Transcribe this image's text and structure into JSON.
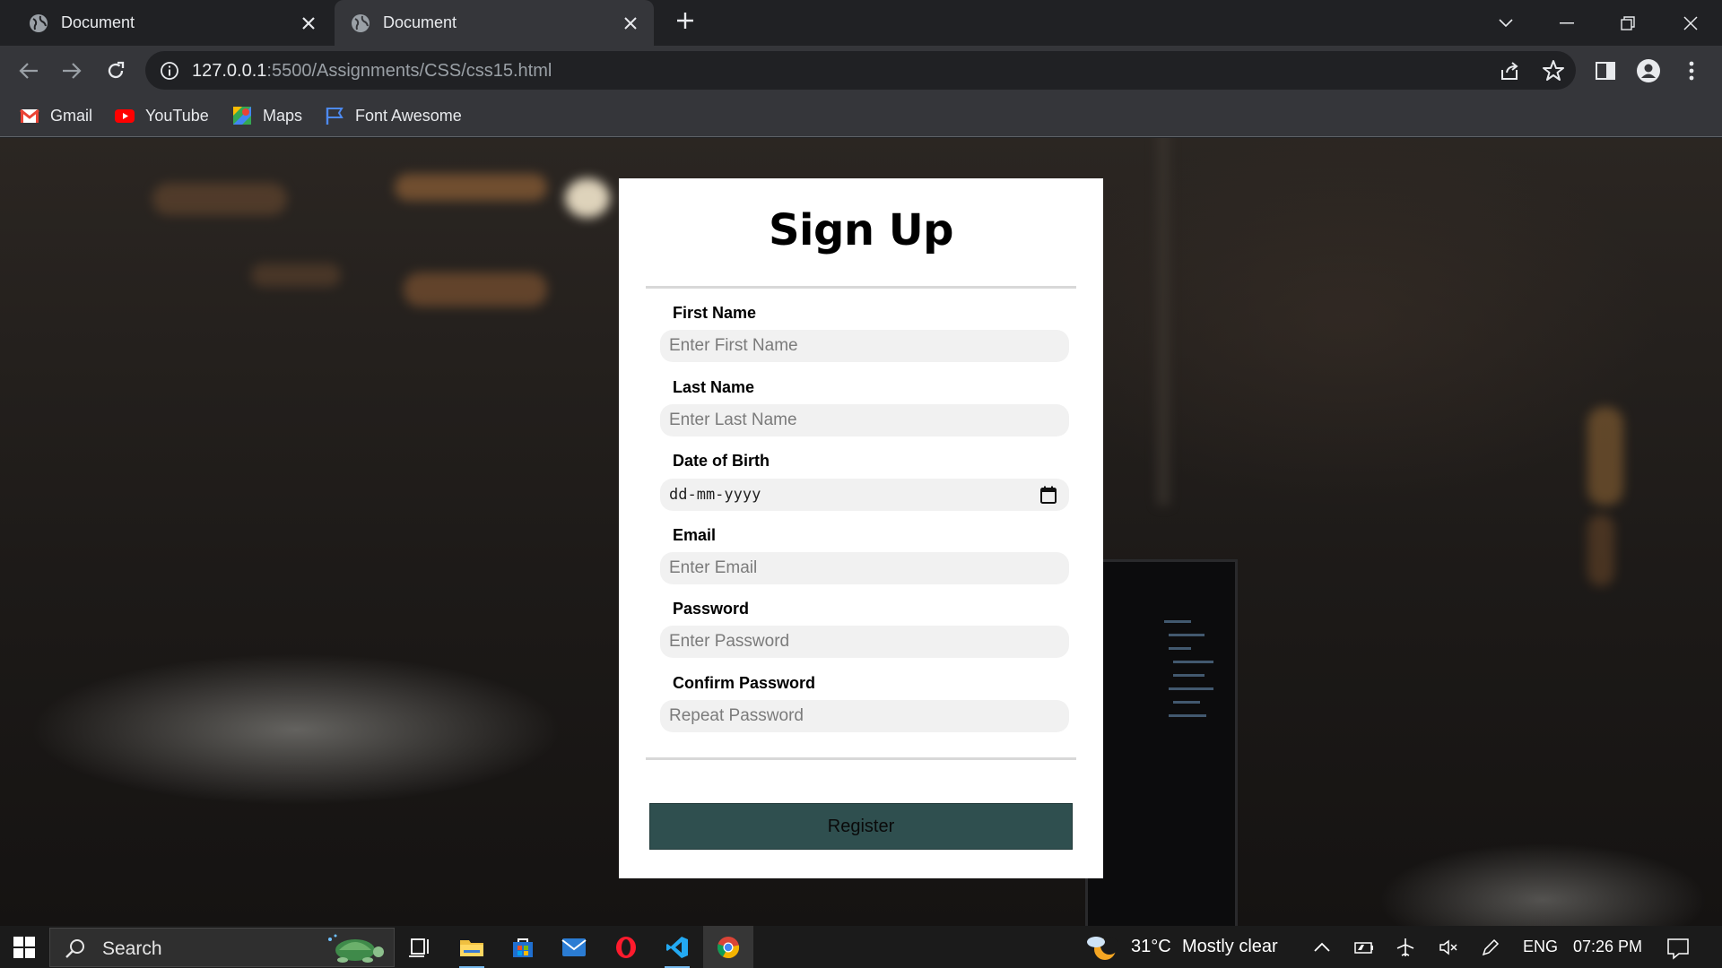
{
  "browser": {
    "tabs": [
      {
        "title": "Document",
        "active": false
      },
      {
        "title": "Document",
        "active": true
      }
    ],
    "address": {
      "host": "127.0.0.1",
      "path": ":5500/Assignments/CSS/css15.html"
    },
    "bookmarks": [
      {
        "label": "Gmail",
        "icon": "gmail-icon"
      },
      {
        "label": "YouTube",
        "icon": "youtube-icon"
      },
      {
        "label": "Maps",
        "icon": "maps-icon"
      },
      {
        "label": "Font Awesome",
        "icon": "flag-icon"
      }
    ]
  },
  "form": {
    "title": "Sign Up",
    "fields": [
      {
        "label": "First Name",
        "placeholder": "Enter First Name"
      },
      {
        "label": "Last Name",
        "placeholder": "Enter Last Name"
      },
      {
        "label": "Date of Birth",
        "value": "dd-mm-yyyy"
      },
      {
        "label": "Email",
        "placeholder": "Enter Email"
      },
      {
        "label": "Password",
        "placeholder": "Enter Password"
      },
      {
        "label": "Confirm Password",
        "placeholder": "Repeat Password"
      }
    ],
    "register_label": "Register",
    "colors": {
      "button": "#2f4f4f",
      "input_bg": "#f1f1f1"
    }
  },
  "taskbar": {
    "search_label": "Search",
    "apps": [
      "task-view-icon",
      "file-explorer-icon",
      "store-icon",
      "mail-icon",
      "opera-icon",
      "vscode-icon",
      "chrome-icon"
    ],
    "weather": {
      "temp": "31°C",
      "condition": "Mostly clear"
    },
    "language": "ENG",
    "time": "07:26 PM"
  }
}
